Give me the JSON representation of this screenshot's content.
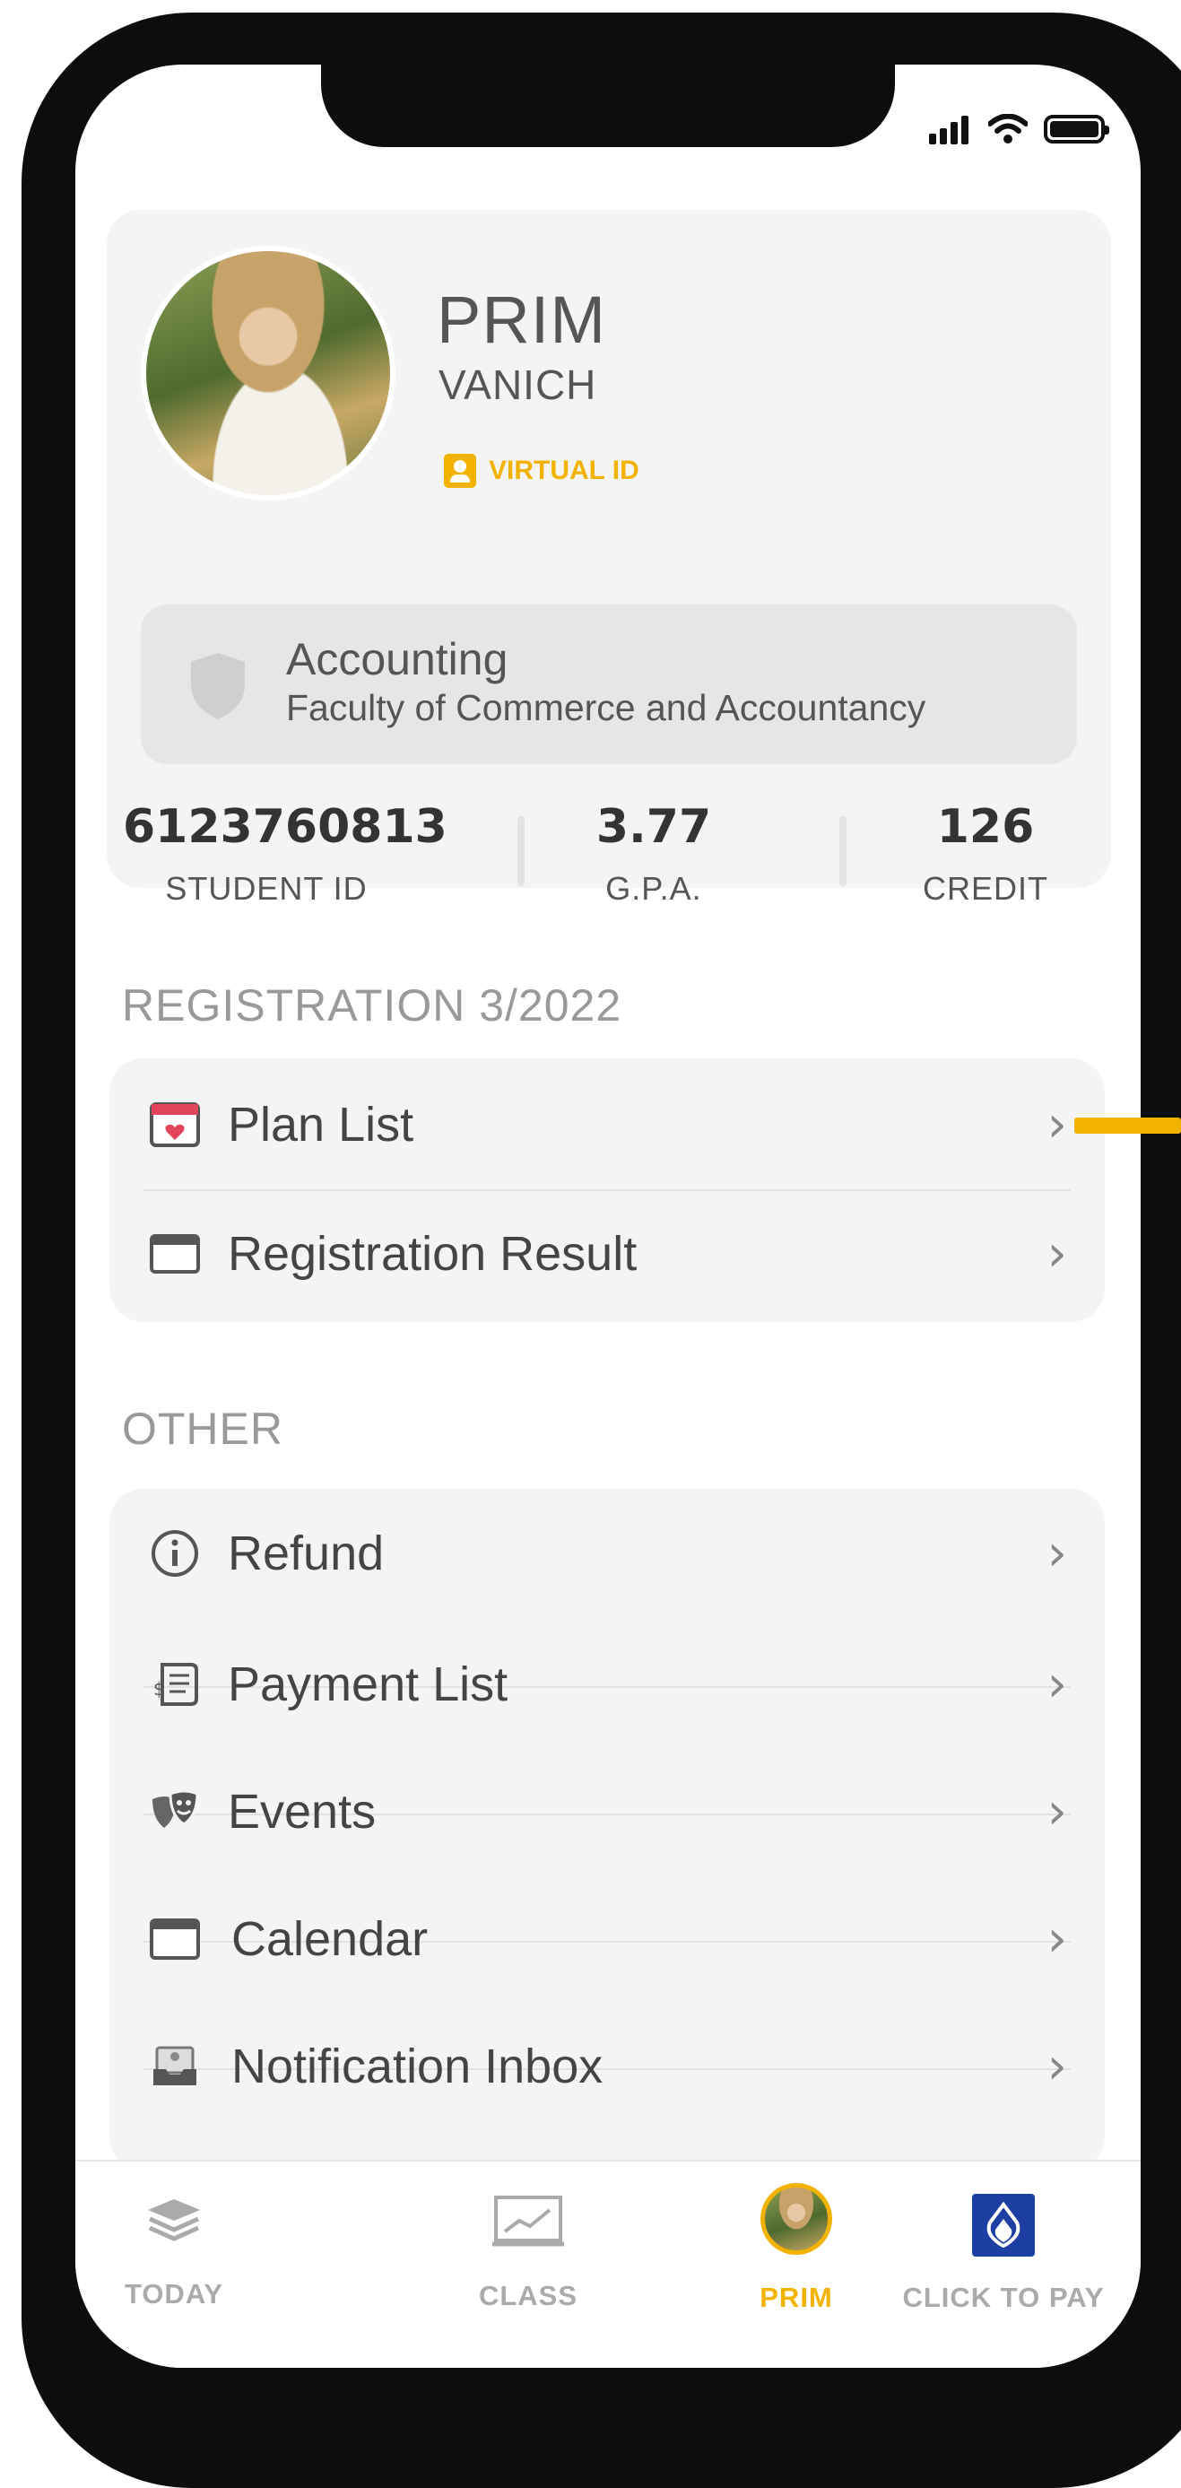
{
  "colors": {
    "accent": "#f2b300",
    "card": "#f4f4f4",
    "frame": "#0d0d0d",
    "pay_blue": "#1d3ea3"
  },
  "status_bar": {
    "signal_icon": "signal-icon",
    "wifi_icon": "wifi-icon",
    "battery_icon": "battery-icon"
  },
  "profile": {
    "first_name": "PRIM",
    "last_name": "VANICH",
    "virtual_id_label": "VIRTUAL ID",
    "major": "Accounting",
    "faculty": "Faculty of Commerce and Accountancy",
    "stats": [
      {
        "value": "6123760813",
        "label": "STUDENT ID"
      },
      {
        "value": "3.77",
        "label": "G.P.A."
      },
      {
        "value": "126",
        "label": "CREDIT"
      }
    ]
  },
  "registration": {
    "title": "REGISTRATION 3/2022",
    "items": [
      {
        "label": "Plan List",
        "icon": "calendar-heart-icon"
      },
      {
        "label": "Registration Result",
        "icon": "card-icon"
      }
    ]
  },
  "other": {
    "title": "OTHER",
    "items": [
      {
        "label": "Refund",
        "icon": "info-icon"
      },
      {
        "label": "Payment List",
        "icon": "receipt-icon"
      },
      {
        "label": "Events",
        "icon": "theater-masks-icon"
      },
      {
        "label": "Calendar",
        "icon": "calendar-icon"
      },
      {
        "label": "Notification Inbox",
        "icon": "inbox-icon"
      }
    ]
  },
  "bottom_nav": [
    {
      "label": "TODAY",
      "icon": "layers-icon",
      "active": false
    },
    {
      "label": "CLASS",
      "icon": "presentation-chart-icon",
      "active": false
    },
    {
      "label": "PRIM",
      "icon": "profile-avatar-icon",
      "active": true
    },
    {
      "label": "CLICK TO PAY",
      "icon": "pay-logo-icon",
      "active": false
    }
  ]
}
